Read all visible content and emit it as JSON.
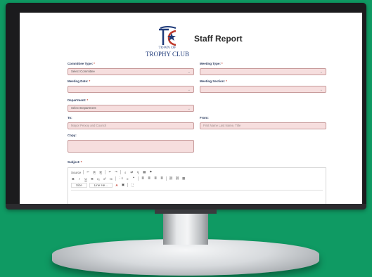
{
  "logo": {
    "town_of": "TOWN OF",
    "name": "TROPHY CLUB"
  },
  "page_title": "Staff Report",
  "form": {
    "committee_type": {
      "label": "Committee Type:",
      "value": "Select Committee"
    },
    "meeting_type": {
      "label": "Meeting Type:",
      "value": ""
    },
    "meeting_date": {
      "label": "Meeting Date:",
      "value": ""
    },
    "meeting_section": {
      "label": "Meeting Section:",
      "value": ""
    },
    "department": {
      "label": "Department:",
      "value": "Select Department"
    },
    "to": {
      "label": "To:",
      "placeholder": "Mayor Peixoy and Council"
    },
    "from": {
      "label": "From:",
      "placeholder": "First Name Last Name, Title"
    },
    "copy": {
      "label": "Copy:",
      "value": ""
    },
    "subject": {
      "label": "Subject:"
    },
    "required_mark": "*"
  },
  "editor": {
    "row1": [
      "Source",
      "✂",
      "⎘",
      "⎗",
      "↶",
      "↷",
      "⌕",
      "⇄",
      "¶",
      "▦",
      "⚑"
    ],
    "row2": [
      "B",
      "I",
      "U",
      "S",
      "x₂",
      "x²",
      "Ix",
      "⋮≡",
      "≡",
      "❝",
      "≣",
      "≣",
      "≣",
      "≣",
      "⛓",
      "⛓",
      "▦"
    ],
    "row3": [
      "Size",
      "Line He...",
      "A",
      "▣",
      "⛶"
    ]
  },
  "colors": {
    "background": "#0f9a63",
    "field_fill": "#f6dede",
    "field_border": "#c79a9a",
    "logo_blue": "#1f3b7a",
    "logo_red": "#c0392b"
  }
}
